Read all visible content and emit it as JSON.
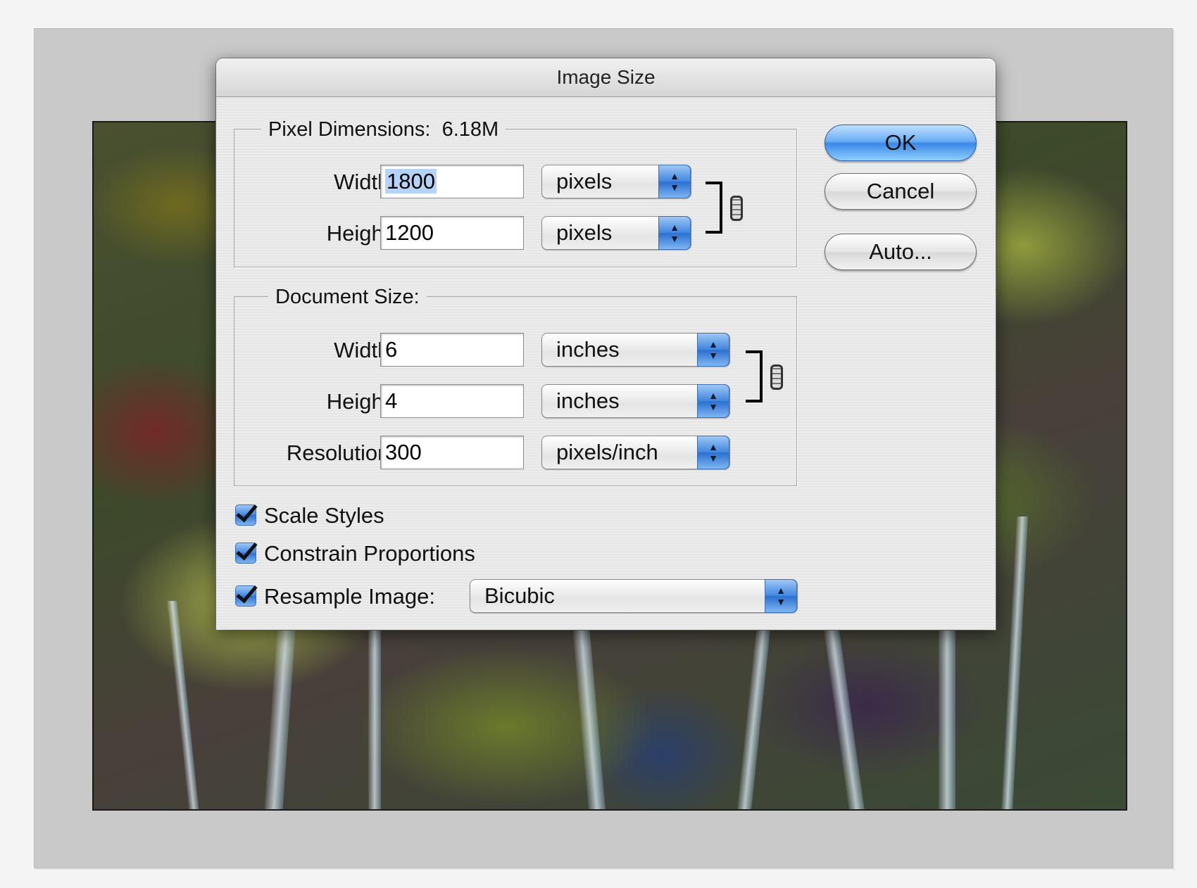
{
  "dialog": {
    "title": "Image Size"
  },
  "pixel_dimensions": {
    "legend": "Pixel Dimensions:",
    "size": "6.18M",
    "width_label": "Width:",
    "width_value": "1800",
    "width_unit": "pixels",
    "height_label": "Height:",
    "height_value": "1200",
    "height_unit": "pixels"
  },
  "document_size": {
    "legend": "Document Size:",
    "width_label": "Width:",
    "width_value": "6",
    "width_unit": "inches",
    "height_label": "Height:",
    "height_value": "4",
    "height_unit": "inches",
    "resolution_label": "Resolution:",
    "resolution_value": "300",
    "resolution_unit": "pixels/inch"
  },
  "buttons": {
    "ok": "OK",
    "cancel": "Cancel",
    "auto": "Auto..."
  },
  "options": {
    "scale_styles": {
      "label": "Scale Styles",
      "checked": true
    },
    "constrain_proportions": {
      "label": "Constrain Proportions",
      "checked": true
    },
    "resample_image": {
      "label": "Resample Image:",
      "checked": true,
      "method": "Bicubic"
    }
  },
  "icons": {
    "chain_link": "chain-link-icon",
    "popup_arrows": "up-down-arrows-icon",
    "checkmark": "checkmark-icon"
  },
  "colors": {
    "accent": "#3f86e0",
    "selection": "#b5d2f7"
  }
}
